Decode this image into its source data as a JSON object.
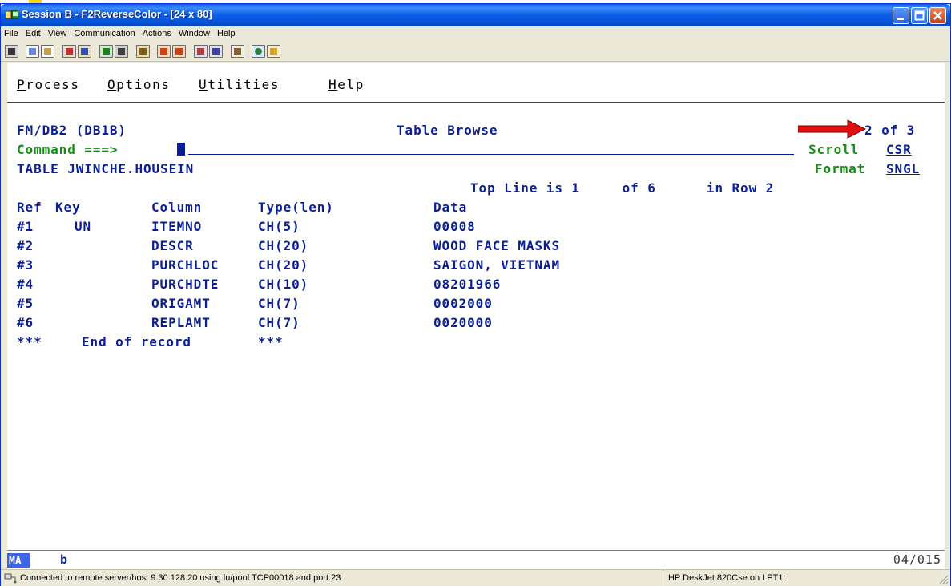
{
  "window": {
    "title": "Session B - F2ReverseColor - [24 x 80]"
  },
  "menubar": [
    "File",
    "Edit",
    "View",
    "Communication",
    "Actions",
    "Window",
    "Help"
  ],
  "toolbar_icons": [
    "print-screen-icon",
    "copy-icon",
    "paste-icon",
    "send-file-icon",
    "receive-file-icon",
    "display-icon",
    "keypad-icon",
    "macro-icon",
    "record-macro-icon",
    "play-macro-icon",
    "transfer-up-icon",
    "transfer-down-icon",
    "clipboard-icon",
    "globe-icon",
    "customize-icon"
  ],
  "pulldown": {
    "items": [
      {
        "mnemonic": "P",
        "rest": "rocess"
      },
      {
        "mnemonic": "O",
        "rest": "ptions"
      },
      {
        "mnemonic": "U",
        "rest": "tilities"
      },
      {
        "mnemonic": "H",
        "rest": "elp"
      }
    ]
  },
  "panel": {
    "id": "FM/DB2 (DB1B)",
    "title": "Table Browse",
    "position": "2 of 3",
    "command_label": "Command ===>",
    "scroll_label": "Scroll",
    "scroll_value": "CSR",
    "table_name": "TABLE JWINCHE.HOUSEIN",
    "format_label": "Format",
    "format_value": "SNGL",
    "top_line_info": "Top Line is 1     of 6      in Row 2"
  },
  "columns": {
    "ref": "Ref",
    "key": "Key",
    "column": "Column",
    "type": "Type(len)",
    "data": "Data"
  },
  "rows": [
    {
      "ref": "#1",
      "key": "UN",
      "column": "ITEMNO",
      "type": "CH(5)",
      "data": "00008"
    },
    {
      "ref": "#2",
      "key": "",
      "column": "DESCR",
      "type": "CH(20)",
      "data": "WOOD FACE MASKS"
    },
    {
      "ref": "#3",
      "key": "",
      "column": "PURCHLOC",
      "type": "CH(20)",
      "data": "SAIGON, VIETNAM"
    },
    {
      "ref": "#4",
      "key": "",
      "column": "PURCHDTE",
      "type": "CH(10)",
      "data": "08201966"
    },
    {
      "ref": "#5",
      "key": "",
      "column": "ORIGAMT",
      "type": "CH(7)",
      "data": "0002000"
    },
    {
      "ref": "#6",
      "key": "",
      "column": "REPLAMT",
      "type": "CH(7)",
      "data": "0020000"
    }
  ],
  "end_marker": {
    "left": "***",
    "text": "End of record",
    "right": "***"
  },
  "oia": {
    "mode": "MA",
    "indicator": "b",
    "cursor_pos": "04/015"
  },
  "statusbar": {
    "connection": "Connected to remote server/host 9.30.128.20 using lu/pool TCP00018 and port 23",
    "printer": "HP DeskJet 820Cse on LPT1:"
  },
  "colors": {
    "field_blue": "#0a1e96",
    "input_green": "#168a16",
    "arrow_red": "#e01010"
  }
}
